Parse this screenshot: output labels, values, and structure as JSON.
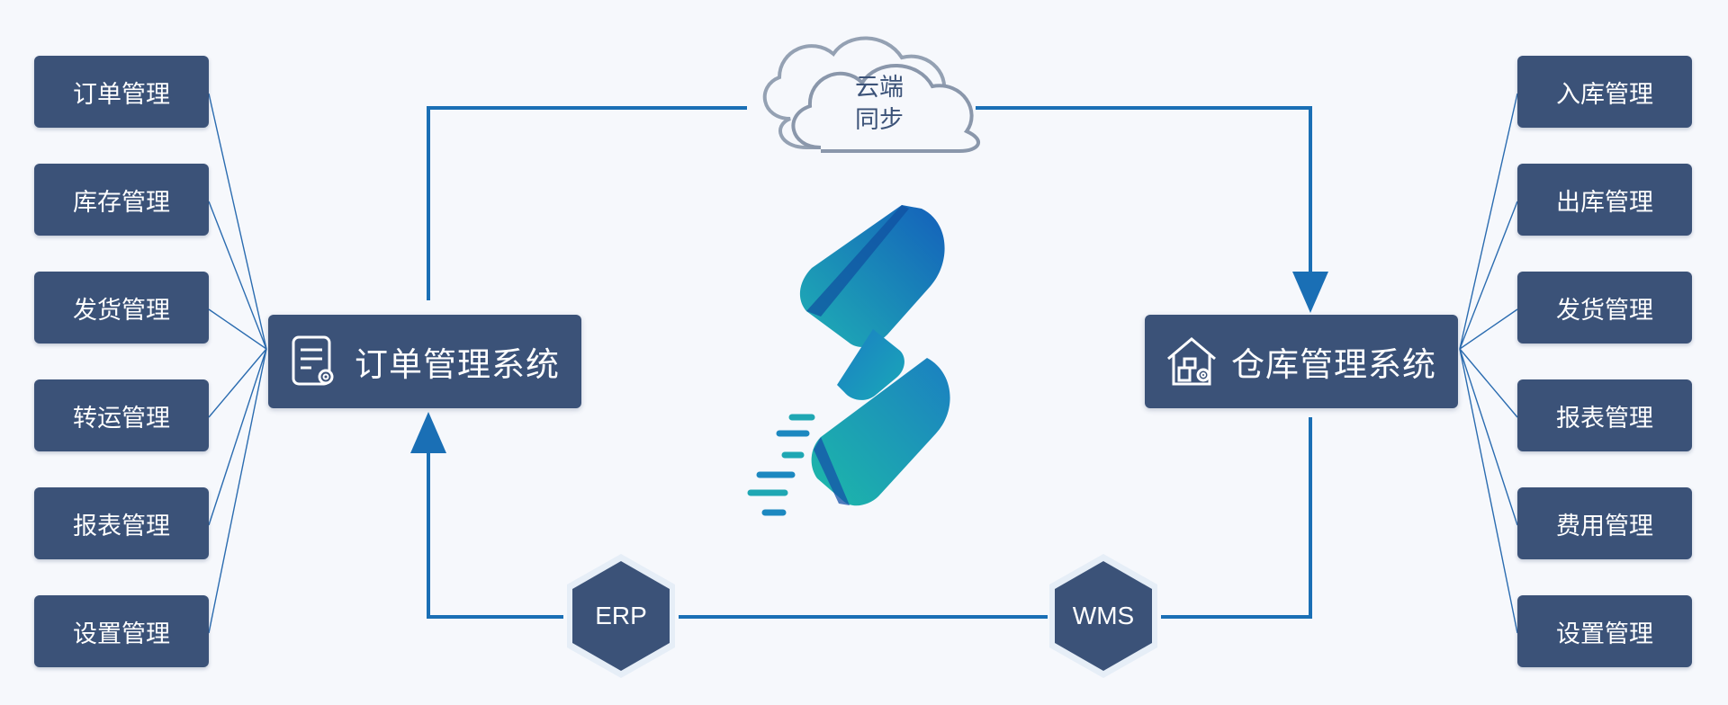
{
  "cloud": {
    "line1": "云端",
    "line2": "同步"
  },
  "order_system": {
    "title": "订单管理系统",
    "icon": "document-settings-icon",
    "modules": [
      "订单管理",
      "库存管理",
      "发货管理",
      "转运管理",
      "报表管理",
      "设置管理"
    ]
  },
  "warehouse_system": {
    "title": "仓库管理系统",
    "icon": "warehouse-settings-icon",
    "modules": [
      "入库管理",
      "出库管理",
      "发货管理",
      "报表管理",
      "费用管理",
      "设置管理"
    ]
  },
  "connectors": {
    "erp": "ERP",
    "wms": "WMS"
  },
  "colors": {
    "box_fill": "#3b5278",
    "flow_line": "#1a6fb5",
    "background": "#f6f8fc",
    "logo_top": "#1565b8",
    "logo_bottom": "#1fb5b0"
  },
  "logo": {
    "icon": "brand-logo-s-icon"
  }
}
